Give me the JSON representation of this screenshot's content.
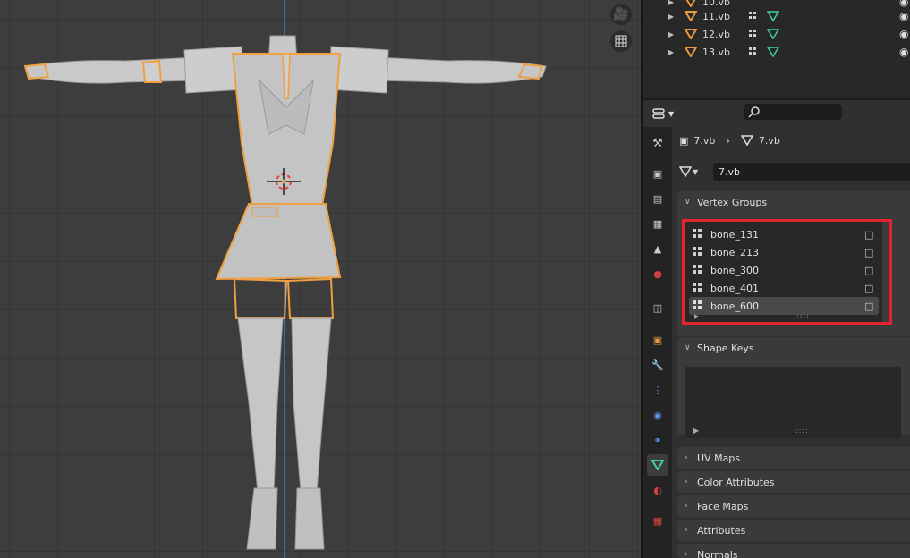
{
  "viewport": {
    "camera_icon": "camera-icon",
    "grid_icon": "grid-icon"
  },
  "outliner": {
    "rows": [
      {
        "label": "10.vb"
      },
      {
        "label": "11.vb"
      },
      {
        "label": "12.vb"
      },
      {
        "label": "13.vb"
      }
    ]
  },
  "properties": {
    "breadcrumb": {
      "object": "7.vb",
      "mesh": "7.vb"
    },
    "mesh_name": "7.vb",
    "panels": {
      "vertex_groups": "Vertex Groups",
      "shape_keys": "Shape Keys",
      "uv_maps": "UV Maps",
      "color_attributes": "Color Attributes",
      "face_maps": "Face Maps",
      "attributes": "Attributes",
      "normals": "Normals"
    },
    "vertex_groups": [
      {
        "name": "bone_131"
      },
      {
        "name": "bone_213"
      },
      {
        "name": "bone_300"
      },
      {
        "name": "bone_401"
      },
      {
        "name": "bone_600"
      }
    ],
    "selected_group_index": 4
  },
  "colors": {
    "highlight": "#e32432",
    "selection_outline": "#f0a040",
    "mesh_icon": "#3fd0a8",
    "object_icon": "#e89a3c"
  }
}
